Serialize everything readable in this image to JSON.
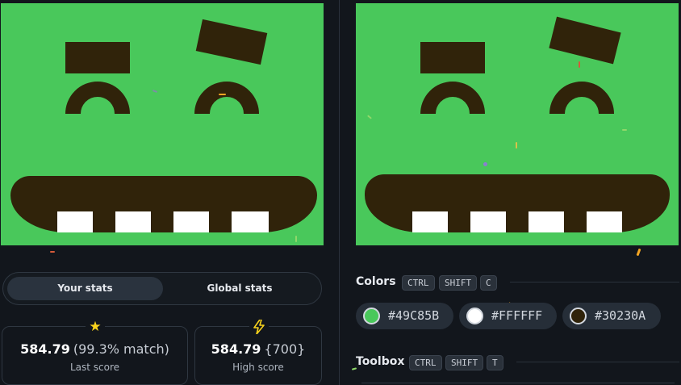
{
  "canvas": {
    "background": "#49C85B",
    "dark": "#30230A",
    "light": "#FFFFFF"
  },
  "stats_toggle": {
    "your_stats": "Your stats",
    "global_stats": "Global stats",
    "active": "Your stats"
  },
  "last_score": {
    "icon": "star-icon",
    "value": "584.79",
    "match": "(99.3% match)",
    "label": "Last score"
  },
  "high_score": {
    "icon": "lightning-icon",
    "value": "584.79",
    "target": "{700}",
    "label": "High score"
  },
  "colors_section": {
    "title": "Colors",
    "shortcut": [
      "CTRL",
      "SHIFT",
      "C"
    ],
    "swatches": [
      {
        "hex": "#49C85B",
        "color": "#49C85B"
      },
      {
        "hex": "#FFFFFF",
        "color": "#FFFFFF"
      },
      {
        "hex": "#30230A",
        "color": "#30230A"
      }
    ]
  },
  "toolbox_section": {
    "title": "Toolbox",
    "shortcut": [
      "CTRL",
      "SHIFT",
      "T"
    ]
  }
}
